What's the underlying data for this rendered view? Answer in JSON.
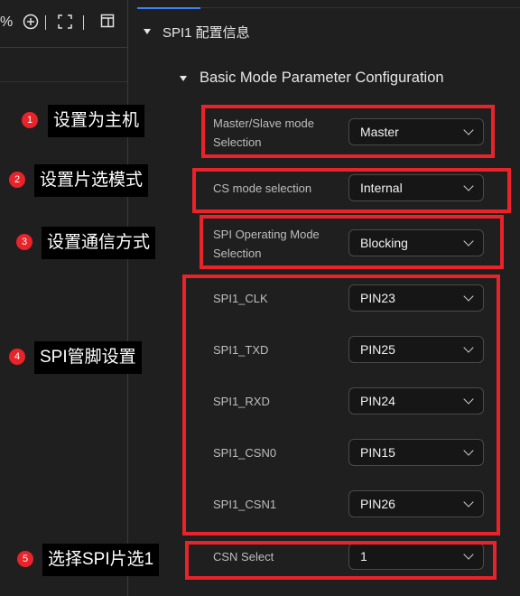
{
  "toolbar": {
    "zoom_symbol": "%"
  },
  "section": {
    "title": "SPI1 配置信息",
    "subtitle": "Basic Mode Parameter Configuration"
  },
  "fields": [
    {
      "label": "Master/Slave mode Selection",
      "value": "Master"
    },
    {
      "label": "CS mode selection",
      "value": "Internal"
    },
    {
      "label": "SPI Operating Mode Selection",
      "value": "Blocking"
    },
    {
      "label": "SPI1_CLK",
      "value": "PIN23"
    },
    {
      "label": "SPI1_TXD",
      "value": "PIN25"
    },
    {
      "label": "SPI1_RXD",
      "value": "PIN24"
    },
    {
      "label": "SPI1_CSN0",
      "value": "PIN15"
    },
    {
      "label": "SPI1_CSN1",
      "value": "PIN26"
    },
    {
      "label": "CSN Select",
      "value": "1"
    }
  ],
  "annotations": [
    {
      "num": "1",
      "text": "设置为主机"
    },
    {
      "num": "2",
      "text": "设置片选模式"
    },
    {
      "num": "3",
      "text": "设置通信方式"
    },
    {
      "num": "4",
      "text": "SPI管脚设置"
    },
    {
      "num": "5",
      "text": "选择SPI片选1"
    }
  ],
  "colors": {
    "highlight": "#e8232a",
    "accent": "#3b82f6",
    "background": "#1f1f1f"
  }
}
